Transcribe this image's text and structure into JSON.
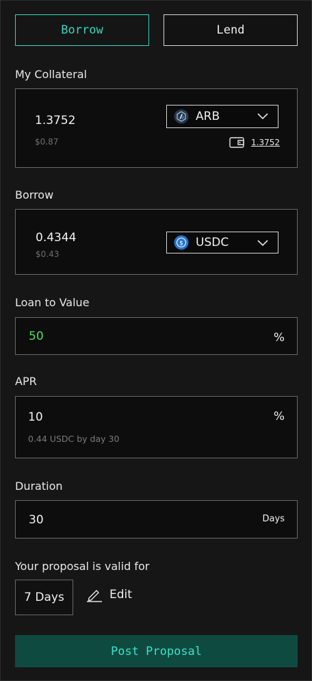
{
  "tabs": {
    "borrow": "Borrow",
    "lend": "Lend"
  },
  "collateral": {
    "label": "My Collateral",
    "amount": "1.3752",
    "usd": "$0.87",
    "token": "ARB",
    "wallet_balance": "1.3752"
  },
  "borrow": {
    "label": "Borrow",
    "amount": "0.4344",
    "usd": "$0.43",
    "token": "USDC"
  },
  "ltv": {
    "label": "Loan to Value",
    "value": "50",
    "unit": "%"
  },
  "apr": {
    "label": "APR",
    "value": "10",
    "unit": "%",
    "hint": "0.44 USDC by day 30"
  },
  "duration": {
    "label": "Duration",
    "value": "30",
    "unit": "Days"
  },
  "validity": {
    "label": "Your proposal is valid for",
    "value": "7 Days",
    "edit": "Edit"
  },
  "submit": "Post Proposal",
  "colors": {
    "accent": "#35d7c1",
    "ltv_value": "#4ee05a",
    "button_bg": "#0f4a41"
  },
  "icons": {
    "collateral_token": "arbitrum-token-icon",
    "borrow_token": "usdc-token-icon",
    "dropdown": "chevron-down-icon",
    "wallet": "wallet-icon",
    "edit": "pencil-icon"
  }
}
